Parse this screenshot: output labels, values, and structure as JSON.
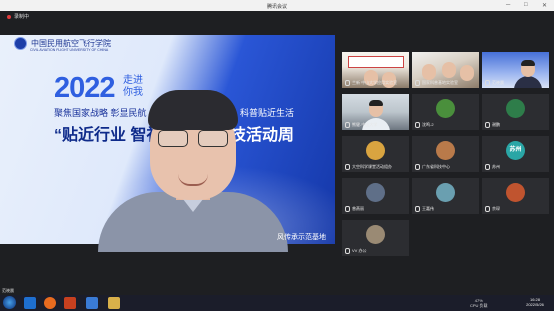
{
  "window": {
    "title": "腾讯会议",
    "controls": [
      "─",
      "□",
      "✕"
    ]
  },
  "recording": {
    "label": "录制中"
  },
  "main_video": {
    "school_cn": "中国民用航空飞行学院",
    "school_en": "CIVIL AVIATION FLIGHT UNIVERSITY OF CHINA",
    "year": "2022",
    "side1": "走进",
    "side2": "你我",
    "line1_left": "聚焦国家战略 彰显民航",
    "line1_right": "科普贴近生活",
    "line2_left": "“贴近行业 智社",
    "line2_right": "技活动周",
    "base_tag": "风传承示范基地"
  },
  "participants": [
    {
      "name": "兰新 中山大学应用实验室",
      "kind": "video1"
    },
    {
      "name": "国家科普基地实验室",
      "kind": "video2"
    },
    {
      "name": "范晓晨",
      "kind": "video3"
    },
    {
      "name": "熊健-中山大学",
      "kind": "video4"
    },
    {
      "name": "沈鸣-2",
      "kind": "avatar",
      "color": "#4a8f3c"
    },
    {
      "name": "谢鹏",
      "kind": "avatar",
      "color": "#2e7d4a"
    },
    {
      "name": "大空科学课堂活动组办",
      "kind": "avatar",
      "color": "#d9a440"
    },
    {
      "name": "广东省科技中心",
      "kind": "avatar",
      "color": "#b97a4a"
    },
    {
      "name": "苏州",
      "kind": "avatar",
      "color": "#2aa6a6",
      "text": "苏州"
    },
    {
      "name": "曾燕丽",
      "kind": "avatar",
      "color": "#5f6f88"
    },
    {
      "name": "王嘉伟",
      "kind": "avatar",
      "color": "#6a9fb0"
    },
    {
      "name": "余琛",
      "kind": "avatar",
      "color": "#c0542f"
    },
    {
      "name": "VV 办公",
      "kind": "avatar",
      "color": "#9a8a74"
    }
  ],
  "status_user": "范晓晨",
  "taskbar": {
    "cpu": "47%",
    "cpu_label": "CPU 负载",
    "time": "16:28",
    "date": "2022/5/26"
  }
}
